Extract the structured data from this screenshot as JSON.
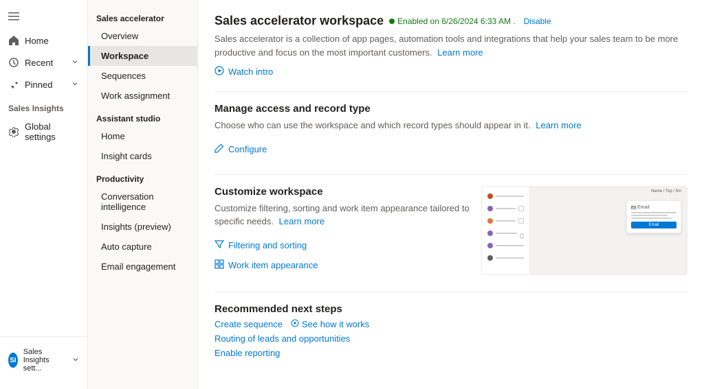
{
  "leftNav": {
    "home_label": "Home",
    "recent_label": "Recent",
    "pinned_label": "Pinned",
    "sales_insights_label": "Sales Insights",
    "global_settings_label": "Global settings"
  },
  "sidebar": {
    "sales_accelerator_label": "Sales accelerator",
    "overview_label": "Overview",
    "workspace_label": "Workspace",
    "sequences_label": "Sequences",
    "work_assignment_label": "Work assignment",
    "assistant_studio_label": "Assistant studio",
    "home_label": "Home",
    "insight_cards_label": "Insight cards",
    "productivity_label": "Productivity",
    "conversation_intelligence_label": "Conversation intelligence",
    "insights_preview_label": "Insights (preview)",
    "auto_capture_label": "Auto capture",
    "email_engagement_label": "Email engagement"
  },
  "main": {
    "page_title": "Sales accelerator workspace",
    "status_text": "Enabled on 6/26/2024 6:33 AM .",
    "disable_label": "Disable",
    "description": "Sales accelerator is a collection of app pages, automation tools and integrations that help your sales team to be more productive and focus on the most important customers.",
    "learn_more_label": "Learn more",
    "watch_intro_label": "Watch intro",
    "manage_access_title": "Manage access and record type",
    "manage_access_desc": "Choose who can use the workspace and which record types should appear in it.",
    "manage_learn_more": "Learn more",
    "configure_label": "Configure",
    "customize_workspace_title": "Customize workspace",
    "customize_desc": "Customize filtering, sorting and work item appearance tailored to specific needs.",
    "customize_learn_more": "Learn more",
    "filtering_sorting_label": "Filtering and sorting",
    "work_item_appearance_label": "Work item appearance",
    "recommended_title": "Recommended next steps",
    "create_sequence_label": "Create sequence",
    "see_how_label": "See how it works",
    "routing_label": "Routing of leads and opportunities",
    "enable_reporting_label": "Enable reporting",
    "preview_email_label": "Email",
    "preview_btn_label": "Email"
  },
  "bottomBar": {
    "label": "Sales Insights sett...",
    "icon": "SI"
  }
}
